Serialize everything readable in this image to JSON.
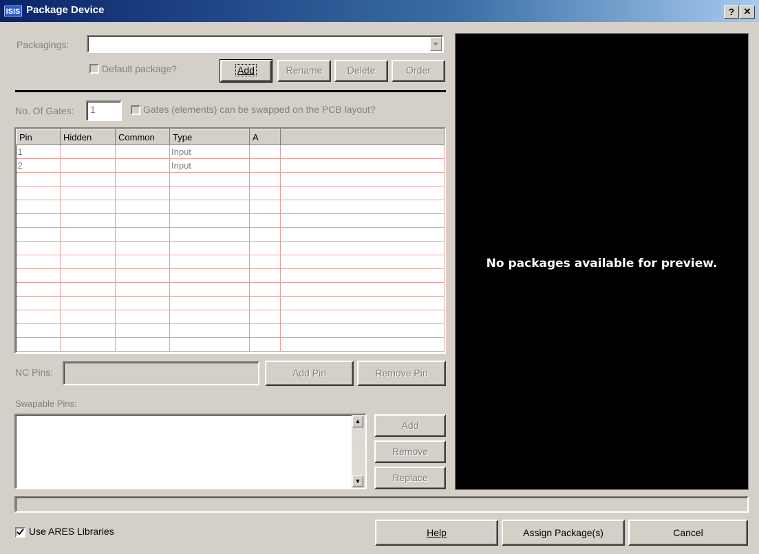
{
  "window": {
    "logo": "ISIS",
    "title": "Package Device",
    "help_btn": "?",
    "close_btn": "✕"
  },
  "packagings": {
    "label": "Packagings:",
    "value": "",
    "default_label": "Default package?",
    "buttons": {
      "add": "Add",
      "rename": "Rename",
      "delete": "Delete",
      "order": "Order"
    }
  },
  "gates": {
    "label": "No. Of Gates:",
    "value": "1",
    "swap_label": "Gates (elements) can be swapped on the PCB layout?"
  },
  "pin_table": {
    "columns": [
      "Pin",
      "Hidden",
      "Common",
      "Type",
      "A"
    ],
    "rows": [
      [
        "1",
        "",
        "",
        "Input",
        ""
      ],
      [
        "2",
        "",
        "",
        "Input",
        ""
      ]
    ]
  },
  "nc_pins": {
    "label": "NC Pins:",
    "value": "",
    "add_pin": "Add Pin",
    "remove_pin": "Remove Pin"
  },
  "swapable": {
    "label": "Swapable Pins:",
    "add": "Add",
    "remove": "Remove",
    "replace": "Replace"
  },
  "preview": {
    "message": "No packages available for preview."
  },
  "footer": {
    "use_ares_label": "Use ARES Libraries",
    "use_ares_checked": true,
    "help": "Help",
    "assign": "Assign Package(s)",
    "cancel": "Cancel"
  },
  "colors": {
    "grid_line": "#e4a0a0",
    "preview_bg": "#000000",
    "titlebar": "#0a246a"
  }
}
